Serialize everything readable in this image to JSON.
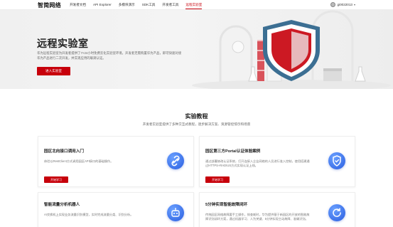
{
  "nav": {
    "logo": "智简网络",
    "links": [
      "开发者文档",
      "API Explorer",
      "多模块演示",
      "SDK工具",
      "开发者工具",
      "远程实验室"
    ],
    "active_index": 5,
    "username": "gi0022013",
    "accent": "#c7000b"
  },
  "hero": {
    "title": "远程实验室",
    "description": "华为远程实验室为开发者提供了7×24小时免费云化实验室环境，开发者无需购置华为产品，即可快速对接华为产品进行二次开发，并实现应用的联调认证。",
    "button_label": "进入实验室"
  },
  "section": {
    "title": "实验教程",
    "subtitle": "开发者实验室提供了多种交互式教程，逐步解决方案、资源管控惊示和场景"
  },
  "cards": [
    {
      "title": "园区北向接口调用入门",
      "description": "体验以RestClient方式调用园区API接口的基础操作。",
      "button_label": "开始学习",
      "icon": "link-icon"
    },
    {
      "title": "园区第三方Portal认证体验案例",
      "description": "通过部署修改认证系统，打开连接入企业网络的人员进行准入控制，使用搭建通过HTTPS+RADIUS方式实现认证上线。",
      "button_label": "开始学习",
      "icon": "shield-icon"
    },
    {
      "title": "智能流量分析机器人",
      "description": "AI交换机上实现业务流量识别模型，实时完成流量分类、识别分析。",
      "icon": "robot-icon"
    },
    {
      "title": "5分钟实现智能故障闭环",
      "description": "传统园区网络故障要手工操作，排查耗时，华为提供基于新园区的开放的智能故障识别闭环方案，通过机器学习、人为关键、5分钟实现主动故障、准确识别。",
      "icon": "refresh-icon"
    }
  ]
}
